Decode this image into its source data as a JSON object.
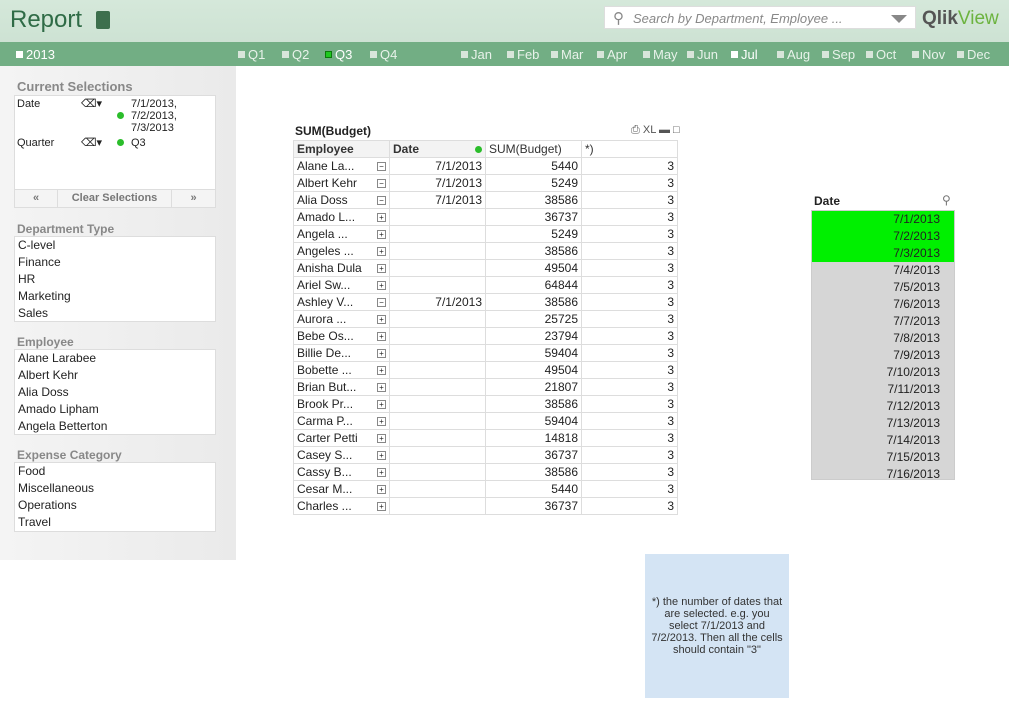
{
  "header": {
    "title": "Report",
    "doc_icon": "document-icon",
    "search_placeholder": "Search by Department, Employee ...",
    "logo_a": "Qlik",
    "logo_b": "View"
  },
  "bar": {
    "year": "2013",
    "quarters": [
      "Q1",
      "Q2",
      "Q3",
      "Q4"
    ],
    "selected_quarter": "Q3",
    "months": [
      "Jan",
      "Feb",
      "Mar",
      "Apr",
      "May",
      "Jun",
      "Jul",
      "Aug",
      "Sep",
      "Oct",
      "Nov",
      "Dec"
    ],
    "active_month": "Jul"
  },
  "current_selections": {
    "title": "Current Selections",
    "rows": [
      {
        "field": "Date",
        "values": [
          "7/1/2013,",
          "7/2/2013,",
          "7/3/2013"
        ]
      },
      {
        "field": "Quarter",
        "values": [
          "Q3"
        ]
      }
    ],
    "clear_label": "Clear Selections"
  },
  "department_type": {
    "title": "Department Type",
    "items": [
      "C-level",
      "Finance",
      "HR",
      "Marketing",
      "Sales"
    ]
  },
  "employee": {
    "title": "Employee",
    "items": [
      "Alane  Larabee",
      "Albert  Kehr",
      "Alia  Doss",
      "Amado  Lipham",
      "Angela  Betterton"
    ]
  },
  "expense_category": {
    "title": "Expense Category",
    "items": [
      "Food",
      "Miscellaneous",
      "Operations",
      "Travel"
    ]
  },
  "table": {
    "title": "SUM(Budget)",
    "print_label": "XL",
    "headers": [
      "Employee",
      "Date",
      "SUM(Budget)",
      "*)"
    ],
    "rows": [
      [
        "Alane  La...",
        "-",
        "7/1/2013",
        "5440",
        "3"
      ],
      [
        "Albert  Kehr",
        "-",
        "7/1/2013",
        "5249",
        "3"
      ],
      [
        "Alia  Doss",
        "-",
        "7/1/2013",
        "38586",
        "3"
      ],
      [
        "Amado  L...",
        "+",
        "",
        "36737",
        "3"
      ],
      [
        "Angela  ...",
        "+",
        "",
        "5249",
        "3"
      ],
      [
        "Angeles ...",
        "+",
        "",
        "38586",
        "3"
      ],
      [
        "Anisha  Dula",
        "+",
        "",
        "49504",
        "3"
      ],
      [
        "Ariel  Sw...",
        "+",
        "",
        "64844",
        "3"
      ],
      [
        "Ashley  V...",
        "-",
        "7/1/2013",
        "38586",
        "3"
      ],
      [
        "Aurora  ...",
        "+",
        "",
        "25725",
        "3"
      ],
      [
        "Bebe  Os...",
        "+",
        "",
        "23794",
        "3"
      ],
      [
        "Billie  De...",
        "+",
        "",
        "59404",
        "3"
      ],
      [
        "Bobette ...",
        "+",
        "",
        "49504",
        "3"
      ],
      [
        "Brian  But...",
        "+",
        "",
        "21807",
        "3"
      ],
      [
        "Brook  Pr...",
        "+",
        "",
        "38586",
        "3"
      ],
      [
        "Carma  P...",
        "+",
        "",
        "59404",
        "3"
      ],
      [
        "Carter  Petti",
        "+",
        "",
        "14818",
        "3"
      ],
      [
        "Casey  S...",
        "+",
        "",
        "36737",
        "3"
      ],
      [
        "Cassy  B...",
        "+",
        "",
        "38586",
        "3"
      ],
      [
        "Cesar  M...",
        "+",
        "",
        "5440",
        "3"
      ],
      [
        "Charles  ...",
        "+",
        "",
        "36737",
        "3"
      ]
    ]
  },
  "date_list": {
    "title": "Date",
    "items": [
      "7/1/2013",
      "7/2/2013",
      "7/3/2013",
      "7/4/2013",
      "7/5/2013",
      "7/6/2013",
      "7/7/2013",
      "7/8/2013",
      "7/9/2013",
      "7/10/2013",
      "7/11/2013",
      "7/12/2013",
      "7/13/2013",
      "7/14/2013",
      "7/15/2013",
      "7/16/2013"
    ],
    "selected": [
      "7/1/2013",
      "7/2/2013",
      "7/3/2013"
    ],
    "selected_color": "#00f000"
  },
  "note": {
    "text": "*) the number of dates that are selected. e.g. you select 7/1/2013 and 7/2/2013. Then all the cells should contain \"3\""
  }
}
